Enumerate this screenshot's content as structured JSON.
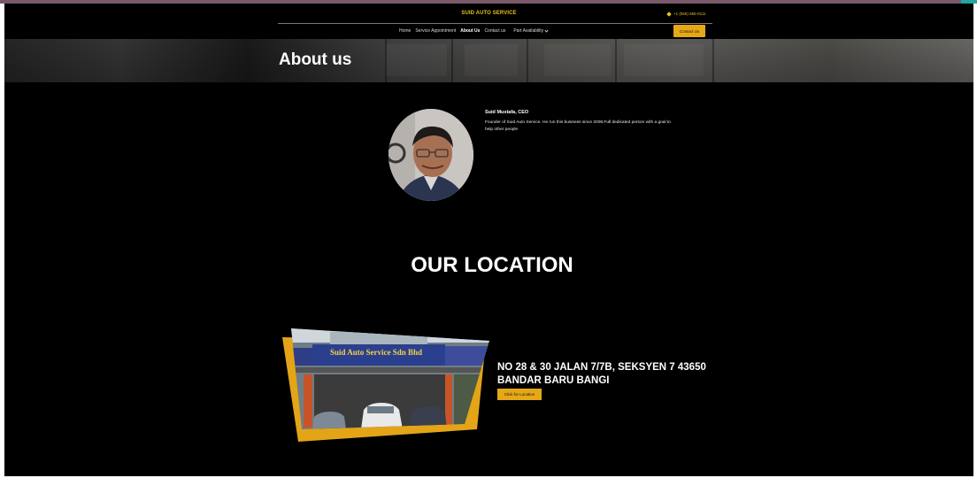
{
  "header": {
    "brand": "SUID AUTO SERVICE",
    "phone": "+1 (555) 555-0111",
    "contact_button": "Contact Us"
  },
  "nav": {
    "items": [
      {
        "label": "Home",
        "active": false
      },
      {
        "label": "Service Appointment",
        "active": false
      },
      {
        "label": "About Us",
        "active": true
      },
      {
        "label": "Contact us",
        "active": false
      }
    ],
    "dropdown_label": "Part Availability"
  },
  "hero": {
    "title": "About us"
  },
  "ceo": {
    "name": "Suid Mustafa, CEO",
    "description": "Founder of Suid Auto Service. He run this business since 2008.Full dedicated person with a goal to help other people"
  },
  "location": {
    "title": "OUR LOCATION",
    "shop_sign": "Suid Auto Service Sdn Bhd",
    "address_line1": "NO 28 & 30 JALAN 7/7B, SEKSYEN 7 43650",
    "address_line2": "BANDAR BARU BANGI",
    "button": "Click for Location"
  },
  "colors": {
    "accent": "#e6a817",
    "brand_text": "#e6c01a",
    "background": "#000000"
  },
  "icons": {
    "phone": "phone-icon",
    "dropdown": "chevron-down-icon"
  }
}
